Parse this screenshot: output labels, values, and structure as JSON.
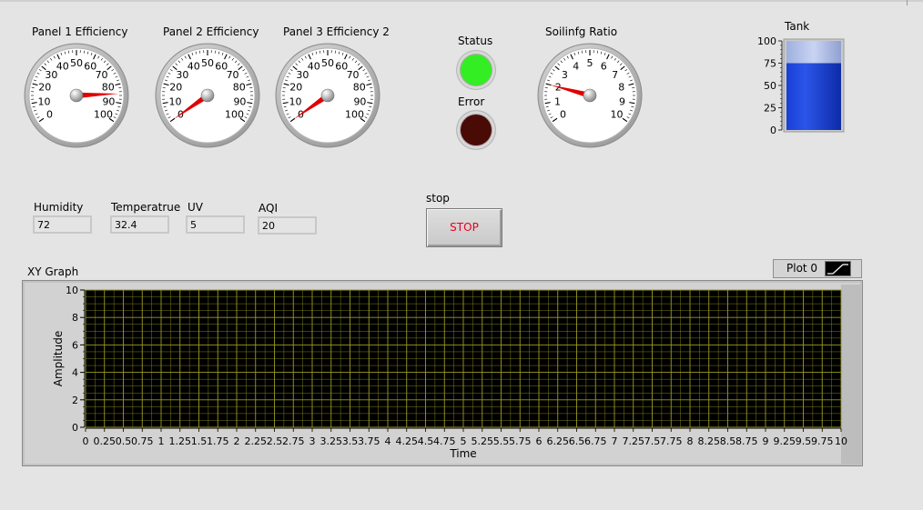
{
  "gauges": [
    {
      "label": "Panel 1 Efficiency",
      "ticks": [
        "0",
        "10",
        "20",
        "30",
        "40",
        "50",
        "60",
        "70",
        "80",
        "90",
        "100"
      ],
      "value": 85
    },
    {
      "label": "Panel 2 Efficiency",
      "ticks": [
        "0",
        "10",
        "20",
        "30",
        "40",
        "50",
        "60",
        "70",
        "80",
        "90",
        "100"
      ],
      "value": 0
    },
    {
      "label": "Panel 3 Efficiency 2",
      "ticks": [
        "0",
        "10",
        "20",
        "30",
        "40",
        "50",
        "60",
        "70",
        "80",
        "90",
        "100"
      ],
      "value": 0
    },
    {
      "label": "Soilinfg Ratio",
      "ticks": [
        "0",
        "1",
        "2",
        "3",
        "4",
        "5",
        "6",
        "7",
        "8",
        "9",
        "10"
      ],
      "value": 2
    }
  ],
  "status": {
    "label": "Status",
    "color": "#33ee22"
  },
  "error": {
    "label": "Error",
    "color": "#4a0a06"
  },
  "tank": {
    "label": "Tank",
    "ticks": [
      "100",
      "75",
      "50",
      "25",
      "0"
    ],
    "value": 75,
    "fill_color": "#2b55e8"
  },
  "indicators": [
    {
      "label": "Humidity",
      "value": "72"
    },
    {
      "label": "Temperatrue",
      "value": "32.4"
    },
    {
      "label": "UV",
      "value": "5"
    },
    {
      "label": "AQI",
      "value": "20"
    }
  ],
  "stop": {
    "caption": "stop",
    "button_label": "STOP"
  },
  "graph": {
    "title": "XY Graph",
    "legend_label": "Plot 0",
    "xlabel": "Time",
    "ylabel": "Amplitude",
    "x_ticks": [
      "0",
      "0.25",
      "0.5",
      "0.75",
      "1",
      "1.25",
      "1.5",
      "1.75",
      "2",
      "2.25",
      "2.5",
      "2.75",
      "3",
      "3.25",
      "3.5",
      "3.75",
      "4",
      "4.25",
      "4.5",
      "4.75",
      "5",
      "5.25",
      "5.5",
      "5.75",
      "6",
      "6.25",
      "6.5",
      "6.75",
      "7",
      "7.25",
      "7.5",
      "7.75",
      "8",
      "8.25",
      "8.5",
      "8.75",
      "9",
      "9.25",
      "9.5",
      "9.75",
      "10"
    ],
    "y_ticks": [
      "0",
      "2",
      "4",
      "6",
      "8",
      "10"
    ],
    "plot_bg": "#000000",
    "grid_color": "#9a9a22"
  },
  "chart_data": {
    "type": "line",
    "title": "XY Graph",
    "xlabel": "Time",
    "ylabel": "Amplitude",
    "xlim": [
      0,
      10
    ],
    "ylim": [
      0,
      10
    ],
    "grid": true,
    "legend": "top-right",
    "series": [
      {
        "name": "Plot 0",
        "x": [],
        "y": []
      }
    ]
  }
}
